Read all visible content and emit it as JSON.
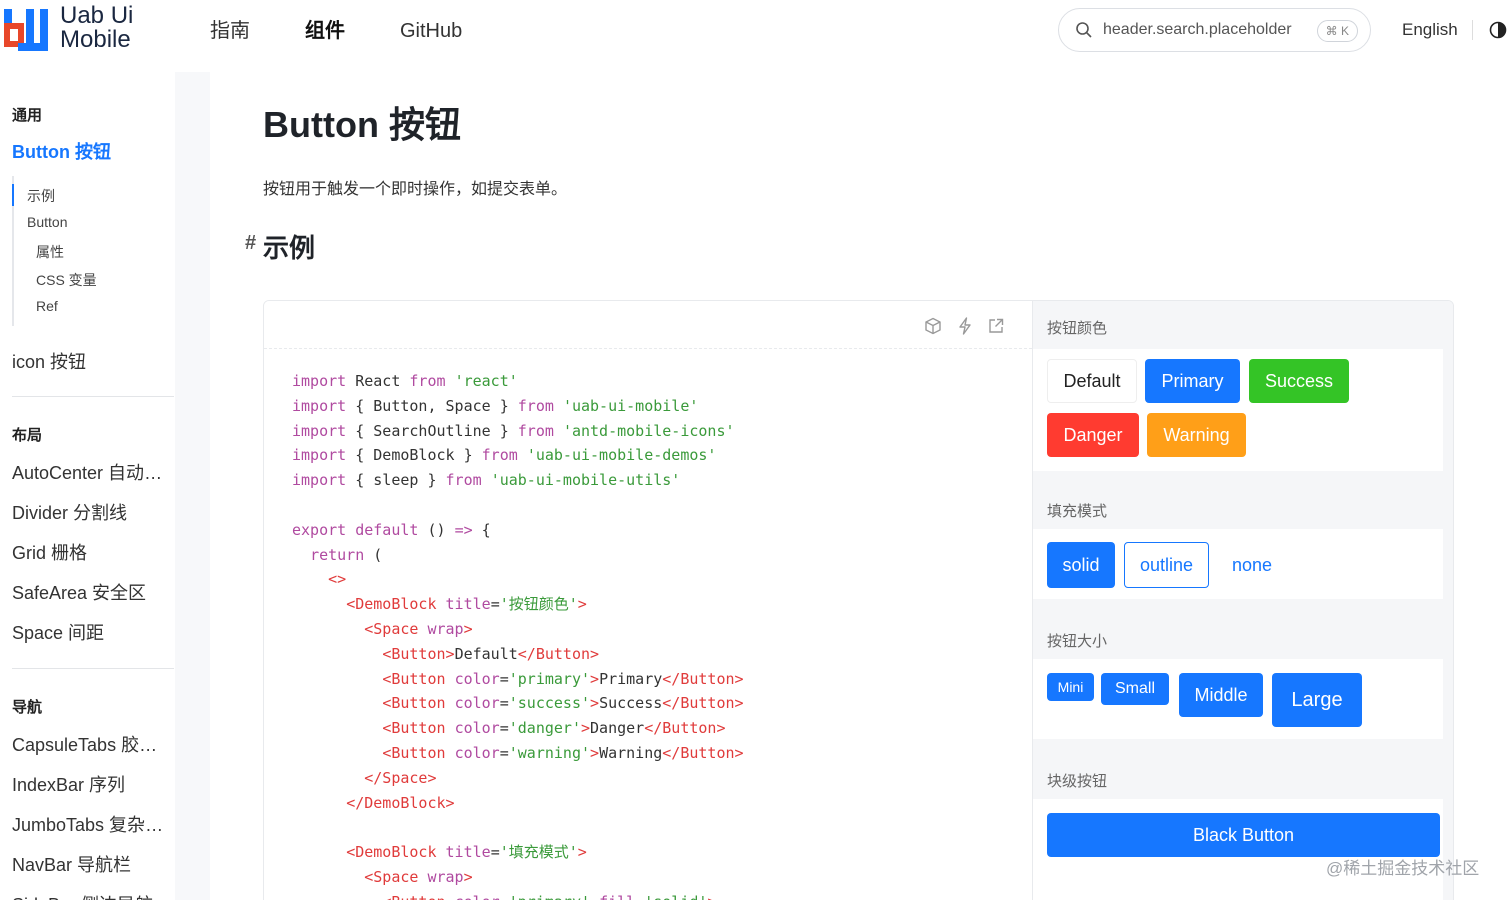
{
  "header": {
    "logo_line1": "Uab Ui",
    "logo_line2": "Mobile",
    "nav": [
      "指南",
      "组件",
      "GitHub"
    ],
    "search_placeholder": "header.search.placeholder",
    "search_shortcut": "⌘ K",
    "language": "English"
  },
  "sidebar": {
    "group_general": "通用",
    "button_link": "Button 按钮",
    "toc": [
      "示例",
      "Button",
      "属性",
      "CSS 变量",
      "Ref"
    ],
    "icon_link": "icon 按钮",
    "group_layout": "布局",
    "layout_items": [
      "AutoCenter 自动居中",
      "Divider 分割线",
      "Grid 栅格",
      "SafeArea 安全区",
      "Space 间距"
    ],
    "group_nav": "导航",
    "nav_items": [
      "CapsuleTabs 胶囊选项卡",
      "IndexBar 序列",
      "JumboTabs 复杂选项卡",
      "NavBar 导航栏",
      "SideBar 侧边导航"
    ]
  },
  "content": {
    "title": "Button 按钮",
    "description": "按钮用于触发一个即时操作，如提交表单。",
    "section_hash": "#",
    "section_title": "示例"
  },
  "code_lines": [
    [
      [
        "kw",
        "import"
      ],
      [
        "pun",
        " React "
      ],
      [
        "kw",
        "from"
      ],
      [
        "pun",
        " "
      ],
      [
        "str",
        "'react'"
      ]
    ],
    [
      [
        "kw",
        "import"
      ],
      [
        "pun",
        " { Button, Space } "
      ],
      [
        "kw",
        "from"
      ],
      [
        "pun",
        " "
      ],
      [
        "str",
        "'uab-ui-mobile'"
      ]
    ],
    [
      [
        "kw",
        "import"
      ],
      [
        "pun",
        " { SearchOutline } "
      ],
      [
        "kw",
        "from"
      ],
      [
        "pun",
        " "
      ],
      [
        "str",
        "'antd-mobile-icons'"
      ]
    ],
    [
      [
        "kw",
        "import"
      ],
      [
        "pun",
        " { DemoBlock } "
      ],
      [
        "kw",
        "from"
      ],
      [
        "pun",
        " "
      ],
      [
        "str",
        "'uab-ui-mobile-demos'"
      ]
    ],
    [
      [
        "kw",
        "import"
      ],
      [
        "pun",
        " { sleep } "
      ],
      [
        "kw",
        "from"
      ],
      [
        "pun",
        " "
      ],
      [
        "str",
        "'uab-ui-mobile-utils'"
      ]
    ],
    [
      [
        "pun",
        ""
      ]
    ],
    [
      [
        "kw",
        "export default"
      ],
      [
        "pun",
        " () "
      ],
      [
        "kw",
        "=>"
      ],
      [
        "pun",
        " {"
      ]
    ],
    [
      [
        "pun",
        "  "
      ],
      [
        "kw",
        "return"
      ],
      [
        "pun",
        " ("
      ]
    ],
    [
      [
        "pun",
        "    "
      ],
      [
        "tag",
        "<>"
      ]
    ],
    [
      [
        "pun",
        "      "
      ],
      [
        "tag",
        "<DemoBlock "
      ],
      [
        "attr",
        "title"
      ],
      [
        "pun",
        "="
      ],
      [
        "str",
        "'按钮颜色'"
      ],
      [
        "tag",
        ">"
      ]
    ],
    [
      [
        "pun",
        "        "
      ],
      [
        "tag",
        "<Space "
      ],
      [
        "attr",
        "wrap"
      ],
      [
        "tag",
        ">"
      ]
    ],
    [
      [
        "pun",
        "          "
      ],
      [
        "tag",
        "<Button>"
      ],
      [
        "pun",
        "Default"
      ],
      [
        "tag",
        "</Button>"
      ]
    ],
    [
      [
        "pun",
        "          "
      ],
      [
        "tag",
        "<Button "
      ],
      [
        "attr",
        "color"
      ],
      [
        "pun",
        "="
      ],
      [
        "str",
        "'primary'"
      ],
      [
        "tag",
        ">"
      ],
      [
        "pun",
        "Primary"
      ],
      [
        "tag",
        "</Button>"
      ]
    ],
    [
      [
        "pun",
        "          "
      ],
      [
        "tag",
        "<Button "
      ],
      [
        "attr",
        "color"
      ],
      [
        "pun",
        "="
      ],
      [
        "str",
        "'success'"
      ],
      [
        "tag",
        ">"
      ],
      [
        "pun",
        "Success"
      ],
      [
        "tag",
        "</Button>"
      ]
    ],
    [
      [
        "pun",
        "          "
      ],
      [
        "tag",
        "<Button "
      ],
      [
        "attr",
        "color"
      ],
      [
        "pun",
        "="
      ],
      [
        "str",
        "'danger'"
      ],
      [
        "tag",
        ">"
      ],
      [
        "pun",
        "Danger"
      ],
      [
        "tag",
        "</Button>"
      ]
    ],
    [
      [
        "pun",
        "          "
      ],
      [
        "tag",
        "<Button "
      ],
      [
        "attr",
        "color"
      ],
      [
        "pun",
        "="
      ],
      [
        "str",
        "'warning'"
      ],
      [
        "tag",
        ">"
      ],
      [
        "pun",
        "Warning"
      ],
      [
        "tag",
        "</Button>"
      ]
    ],
    [
      [
        "pun",
        "        "
      ],
      [
        "tag",
        "</Space>"
      ]
    ],
    [
      [
        "pun",
        "      "
      ],
      [
        "tag",
        "</DemoBlock>"
      ]
    ],
    [
      [
        "pun",
        ""
      ]
    ],
    [
      [
        "pun",
        "      "
      ],
      [
        "tag",
        "<DemoBlock "
      ],
      [
        "attr",
        "title"
      ],
      [
        "pun",
        "="
      ],
      [
        "str",
        "'填充模式'"
      ],
      [
        "tag",
        ">"
      ]
    ],
    [
      [
        "pun",
        "        "
      ],
      [
        "tag",
        "<Space "
      ],
      [
        "attr",
        "wrap"
      ],
      [
        "tag",
        ">"
      ]
    ],
    [
      [
        "pun",
        "          "
      ],
      [
        "tag",
        "<Button "
      ],
      [
        "attr",
        "color"
      ],
      [
        "pun",
        "="
      ],
      [
        "str",
        "'primary'"
      ],
      [
        "pun",
        " "
      ],
      [
        "attr",
        "fill"
      ],
      [
        "pun",
        "="
      ],
      [
        "str",
        "'solid'"
      ],
      [
        "tag",
        ">"
      ]
    ]
  ],
  "preview": {
    "color_title": "按钮颜色",
    "color_buttons": [
      "Default",
      "Primary",
      "Success",
      "Danger",
      "Warning"
    ],
    "fill_title": "填充模式",
    "fill_buttons": [
      "solid",
      "outline",
      "none"
    ],
    "size_title": "按钮大小",
    "size_buttons": [
      "Mini",
      "Small",
      "Middle",
      "Large"
    ],
    "block_title": "块级按钮",
    "block_button": "Black Button"
  },
  "watermark": "@稀土掘金技术社区",
  "colors": {
    "primary": "#1677ff",
    "success": "#34c426",
    "danger": "#ff3b30",
    "warning": "#ff9f18"
  }
}
